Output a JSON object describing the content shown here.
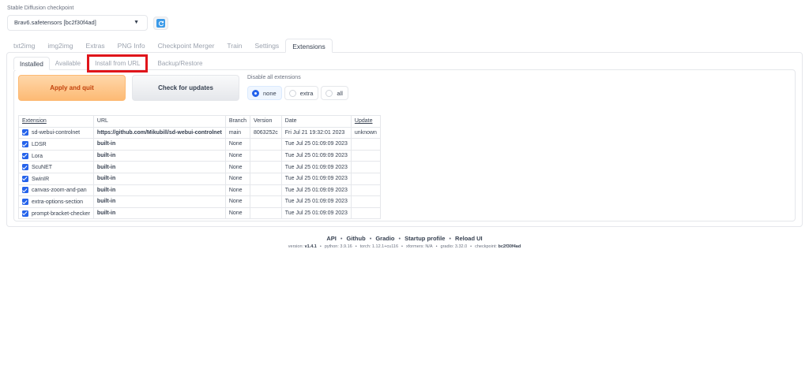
{
  "checkpoint": {
    "label": "Stable Diffusion checkpoint",
    "value": "Brav6.safetensors [bc2f30f4ad]"
  },
  "main_tabs": [
    {
      "label": "txt2img"
    },
    {
      "label": "img2img"
    },
    {
      "label": "Extras"
    },
    {
      "label": "PNG Info"
    },
    {
      "label": "Checkpoint Merger"
    },
    {
      "label": "Train"
    },
    {
      "label": "Settings"
    },
    {
      "label": "Extensions",
      "active": true
    }
  ],
  "sub_tabs": [
    {
      "label": "Installed",
      "active": true
    },
    {
      "label": "Available"
    },
    {
      "label": "Install from URL",
      "highlighted": true
    },
    {
      "label": "Backup/Restore"
    }
  ],
  "buttons": {
    "apply": "Apply and quit",
    "check": "Check for updates"
  },
  "disable_all": {
    "label": "Disable all extensions",
    "options": [
      "none",
      "extra",
      "all"
    ],
    "selected": "none"
  },
  "table": {
    "headers": [
      "Extension",
      "URL",
      "Branch",
      "Version",
      "Date",
      "Update"
    ],
    "rows": [
      {
        "name": "sd-webui-controlnet",
        "url": "https://github.com/Mikubill/sd-webui-controlnet",
        "branch": "main",
        "version": "8063252c",
        "date": "Fri Jul 21 19:32:01 2023",
        "update": "unknown",
        "checked": true
      },
      {
        "name": "LDSR",
        "url": "built-in",
        "branch": "None",
        "version": "",
        "date": "Tue Jul 25 01:09:09 2023",
        "update": "",
        "checked": true
      },
      {
        "name": "Lora",
        "url": "built-in",
        "branch": "None",
        "version": "",
        "date": "Tue Jul 25 01:09:09 2023",
        "update": "",
        "checked": true
      },
      {
        "name": "ScuNET",
        "url": "built-in",
        "branch": "None",
        "version": "",
        "date": "Tue Jul 25 01:09:09 2023",
        "update": "",
        "checked": true
      },
      {
        "name": "SwinIR",
        "url": "built-in",
        "branch": "None",
        "version": "",
        "date": "Tue Jul 25 01:09:09 2023",
        "update": "",
        "checked": true
      },
      {
        "name": "canvas-zoom-and-pan",
        "url": "built-in",
        "branch": "None",
        "version": "",
        "date": "Tue Jul 25 01:09:09 2023",
        "update": "",
        "checked": true
      },
      {
        "name": "extra-options-section",
        "url": "built-in",
        "branch": "None",
        "version": "",
        "date": "Tue Jul 25 01:09:09 2023",
        "update": "",
        "checked": true
      },
      {
        "name": "prompt-bracket-checker",
        "url": "built-in",
        "branch": "None",
        "version": "",
        "date": "Tue Jul 25 01:09:09 2023",
        "update": "",
        "checked": true
      }
    ]
  },
  "footer": {
    "links": [
      "API",
      "Github",
      "Gradio",
      "Startup profile",
      "Reload UI"
    ],
    "versions": [
      {
        "key": "version:",
        "value": "v1.4.1",
        "bold": true
      },
      {
        "key": "python:",
        "value": "3.9.16"
      },
      {
        "key": "torch:",
        "value": "1.12.1+cu116"
      },
      {
        "key": "xformers:",
        "value": "N/A"
      },
      {
        "key": "gradio:",
        "value": "3.32.0"
      },
      {
        "key": "checkpoint:",
        "value": "bc2f30f4ad",
        "bold": true
      }
    ]
  },
  "colors": {
    "accent": "#2563eb",
    "primary_button": "#fdba74",
    "highlight_box": "#e0151b"
  }
}
